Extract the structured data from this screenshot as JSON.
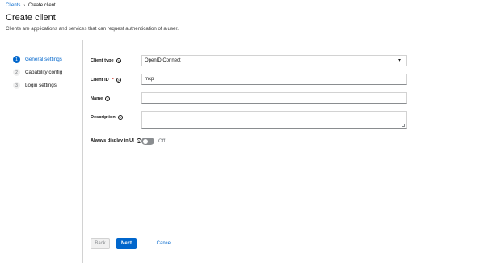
{
  "breadcrumb": {
    "parent": "Clients",
    "separator": "›",
    "current": "Create client"
  },
  "header": {
    "title": "Create client",
    "description": "Clients are applications and services that can request authentication of a user."
  },
  "wizard": {
    "steps": [
      {
        "number": "1",
        "label": "General settings",
        "active": true
      },
      {
        "number": "2",
        "label": "Capability config",
        "active": false
      },
      {
        "number": "3",
        "label": "Login settings",
        "active": false
      }
    ]
  },
  "form": {
    "client_type": {
      "label": "Client type",
      "value": "OpenID Connect"
    },
    "client_id": {
      "label": "Client ID",
      "required": "*",
      "value": "mcp"
    },
    "name": {
      "label": "Name",
      "value": ""
    },
    "description": {
      "label": "Description",
      "value": ""
    },
    "always_display": {
      "label": "Always display in UI",
      "state_text": "Off"
    },
    "help_glyph": "?"
  },
  "footer": {
    "back_label": "Back",
    "next_label": "Next",
    "cancel_label": "Cancel"
  },
  "colors": {
    "accent": "#0066cc",
    "border": "#d2d2d2",
    "text": "#151515",
    "required": "#c9190b"
  },
  "icons": {
    "help": "question-circle-icon",
    "dropdown": "caret-down-icon"
  }
}
